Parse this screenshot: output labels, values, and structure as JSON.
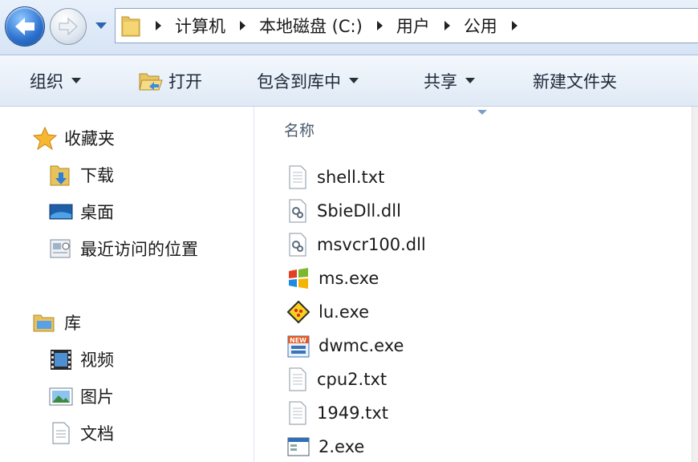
{
  "address": {
    "crumbs": [
      "计算机",
      "本地磁盘 (C:)",
      "用户",
      "公用"
    ]
  },
  "toolbar": {
    "organize": "组织",
    "open": "打开",
    "include": "包含到库中",
    "share": "共享",
    "new_folder": "新建文件夹"
  },
  "nav": {
    "favorites": "收藏夹",
    "downloads": "下载",
    "desktop": "桌面",
    "recent": "最近访问的位置",
    "libraries": "库",
    "videos": "视频",
    "pictures": "图片",
    "documents": "文档"
  },
  "files": {
    "column_name": "名称",
    "items": [
      {
        "name": "shell.txt",
        "icon": "text-file-icon"
      },
      {
        "name": "SbieDll.dll",
        "icon": "dll-file-icon"
      },
      {
        "name": "msvcr100.dll",
        "icon": "dll-file-icon"
      },
      {
        "name": "ms.exe",
        "icon": "windows-logo-exe-icon"
      },
      {
        "name": "lu.exe",
        "icon": "yellow-diamond-exe-icon"
      },
      {
        "name": "dwmc.exe",
        "icon": "new-badge-exe-icon"
      },
      {
        "name": "cpu2.txt",
        "icon": "text-file-icon"
      },
      {
        "name": "1949.txt",
        "icon": "text-file-icon"
      },
      {
        "name": "2.exe",
        "icon": "application-window-icon"
      }
    ]
  }
}
